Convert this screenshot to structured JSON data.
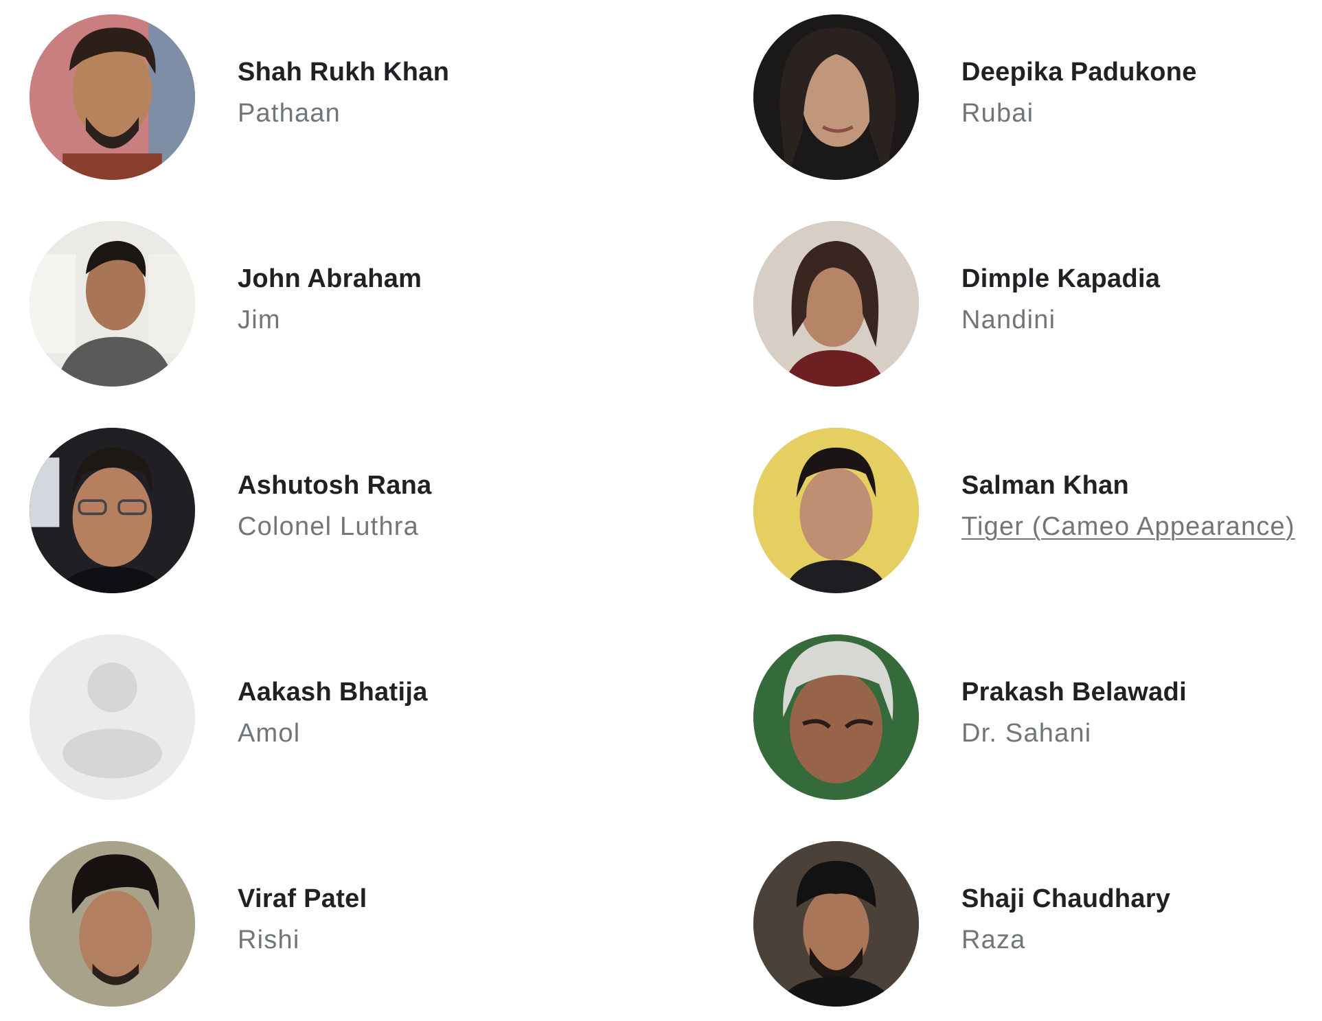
{
  "cast": [
    {
      "actor": "Shah Rukh Khan",
      "role": "Pathaan"
    },
    {
      "actor": "Deepika Padukone",
      "role": "Rubai"
    },
    {
      "actor": "John Abraham",
      "role": "Jim"
    },
    {
      "actor": "Dimple Kapadia",
      "role": "Nandini"
    },
    {
      "actor": "Ashutosh Rana",
      "role": "Colonel Luthra"
    },
    {
      "actor": "Salman Khan",
      "role": "Tiger (Cameo Appearance)"
    },
    {
      "actor": "Aakash Bhatija",
      "role": "Amol"
    },
    {
      "actor": "Prakash Belawadi",
      "role": "Dr. Sahani"
    },
    {
      "actor": "Viraf Patel",
      "role": "Rishi"
    },
    {
      "actor": "Shaji Chaudhary",
      "role": "Raza"
    }
  ],
  "colors": {
    "name": "#202124",
    "role": "#70757a",
    "placeholder_bg": "#ebebeb",
    "placeholder_figure": "#d6d6d6"
  }
}
